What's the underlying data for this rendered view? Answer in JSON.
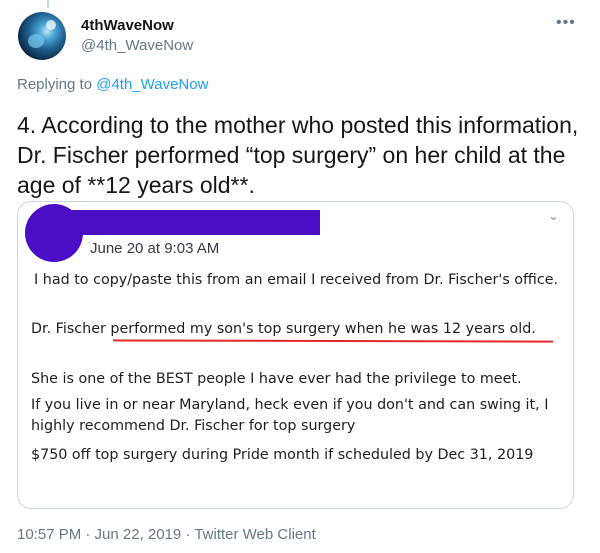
{
  "author": {
    "display_name": "4thWaveNow",
    "handle": "@4th_WaveNow"
  },
  "more_icon": "more-horizontal-icon",
  "replying": {
    "prefix": "Replying to ",
    "target": "@4th_WaveNow"
  },
  "tweet_text": "4.  According to the mother who posted this information, Dr. Fischer performed “top surgery” on her child at the age of **12 years old**.",
  "embedded_post": {
    "date": "June 20 at 9:03 AM",
    "paragraphs": [
      "I had to copy/paste this from an email I received from Dr. Fischer's office.",
      "Dr. Fischer performed my son's top surgery when he was 12 years old.",
      "She is one of the BEST people I have ever had the privilege to meet.",
      "If you live in or near Maryland, heck even if you don't and can swing it, I highly recommend Dr. Fischer for top surgery",
      "$750 off top surgery during Pride month if scheduled by Dec 31, 2019"
    ],
    "underline_color": "#e32626",
    "redaction_color": "#4a0fc4"
  },
  "footer": {
    "timestamp": "10:57 PM · Jun 22, 2019 · Twitter Web Client"
  },
  "colors": {
    "link": "#1da1f2",
    "secondary_text": "#657786",
    "border": "#ccd6dd"
  }
}
